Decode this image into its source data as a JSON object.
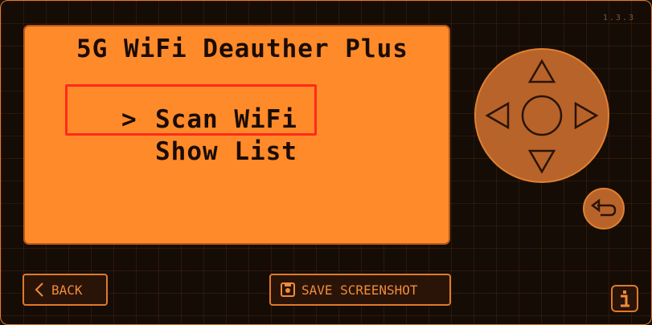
{
  "app": {
    "version": "1.3.3"
  },
  "screen": {
    "title": "5G WiFi Deauther Plus",
    "cursor": ">",
    "menu": [
      {
        "label": "Scan WiFi",
        "selected": true
      },
      {
        "label": "Show List",
        "selected": false
      }
    ]
  },
  "controls": {
    "back_label": "BACK",
    "save_label": "SAVE SCREENSHOT"
  },
  "icons": {
    "up": "triangle-up-icon",
    "down": "triangle-down-icon",
    "left": "triangle-left-icon",
    "right": "triangle-right-icon",
    "return": "return-arrow-icon",
    "info": "info-icon",
    "save": "save-icon",
    "back": "chevron-left-icon"
  },
  "colors": {
    "accent": "#ff8a2a",
    "highlight": "#ff2a1a",
    "background": "#150c06",
    "dpad": "#b8632a"
  }
}
